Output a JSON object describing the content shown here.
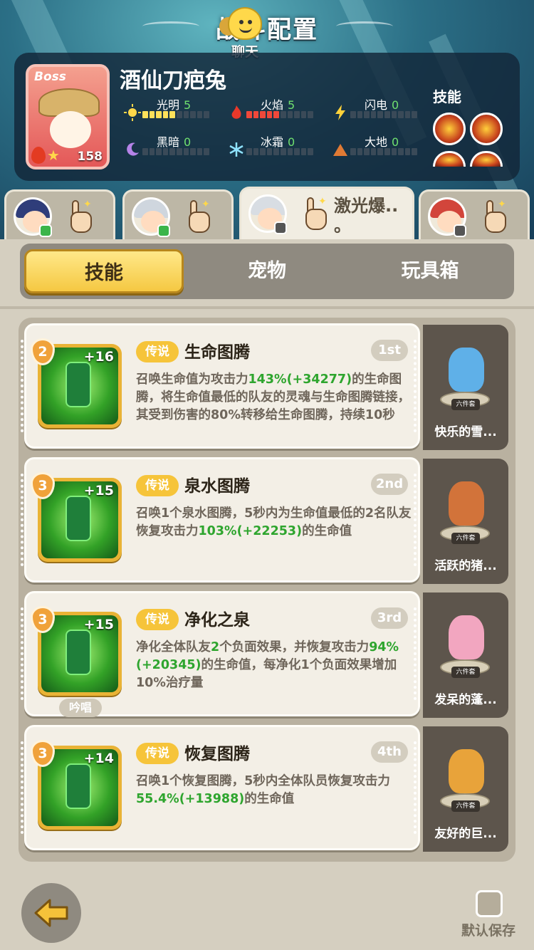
{
  "header": {
    "title": "战斗配置",
    "chat_label": "聊天"
  },
  "boss": {
    "tag": "Boss",
    "name": "酒仙刀疤兔",
    "level": "158",
    "skills_label": "技能",
    "elements": [
      {
        "name": "光明",
        "value": "5",
        "filled": 5,
        "color": "#ffe15a"
      },
      {
        "name": "火焰",
        "value": "5",
        "filled": 5,
        "color": "#f0483a"
      },
      {
        "name": "闪电",
        "value": "0",
        "filled": 0,
        "color": "#ffe15a"
      },
      {
        "name": "黑暗",
        "value": "0",
        "filled": 0,
        "color": "#ffe15a"
      },
      {
        "name": "冰霜",
        "value": "0",
        "filled": 0,
        "color": "#ffe15a"
      },
      {
        "name": "大地",
        "value": "0",
        "filled": 0,
        "color": "#ffe15a"
      }
    ]
  },
  "hero_tabs": [
    {
      "hair": "#2f3d7a",
      "status": "green"
    },
    {
      "hair": "#cfd6de",
      "status": "green"
    },
    {
      "hair": "#d8dde3",
      "status": "grey",
      "label_line1": "激光爆..",
      "label_line2": "。"
    },
    {
      "hair": "#d2453b",
      "status": "grey"
    }
  ],
  "segments": {
    "tab1": "技能",
    "tab2": "宠物",
    "tab3": "玩具箱"
  },
  "skills": [
    {
      "level": "2",
      "plus": "+16",
      "tag": "传说",
      "name": "生命图腾",
      "rank": "1st",
      "desc_parts": [
        "召唤生命值为攻击力",
        "143%(+34277)",
        "的生命图腾，将生命值最低的队友的灵魂与生命图腾链接，其受到伤害的80%转移给生命图腾，持续10秒"
      ],
      "pet_name": "快乐的雪...",
      "pet_set": "六件套",
      "pet_color": "#5fb0e8"
    },
    {
      "level": "3",
      "plus": "+15",
      "tag": "传说",
      "name": "泉水图腾",
      "rank": "2nd",
      "desc_parts": [
        "召唤1个泉水图腾，5秒内为生命值最低的2名队友恢复攻击力",
        "103%(+22253)",
        "的生命值"
      ],
      "pet_name": "活跃的猪...",
      "pet_set": "六件套",
      "pet_color": "#d2733a"
    },
    {
      "level": "3",
      "plus": "+15",
      "tag": "传说",
      "name": "净化之泉",
      "rank": "3rd",
      "desc_parts": [
        "净化全体队友",
        "2",
        "个负面效果，并恢复攻击力",
        "94%(+20345)",
        "的生命值，每净化1个负面效果增加10%治疗量"
      ],
      "chant": "吟唱",
      "pet_name": "发呆的蓬...",
      "pet_set": "六件套",
      "pet_color": "#f2a6c0"
    },
    {
      "level": "3",
      "plus": "+14",
      "tag": "传说",
      "name": "恢复图腾",
      "rank": "4th",
      "desc_parts": [
        "召唤1个恢复图腾，5秒内全体队员恢复攻击力",
        "55.4%(+13988)",
        "的生命值"
      ],
      "pet_name": "友好的巨...",
      "pet_set": "六件套",
      "pet_color": "#e8a33a"
    }
  ],
  "footer": {
    "save_label": "默认保存"
  }
}
